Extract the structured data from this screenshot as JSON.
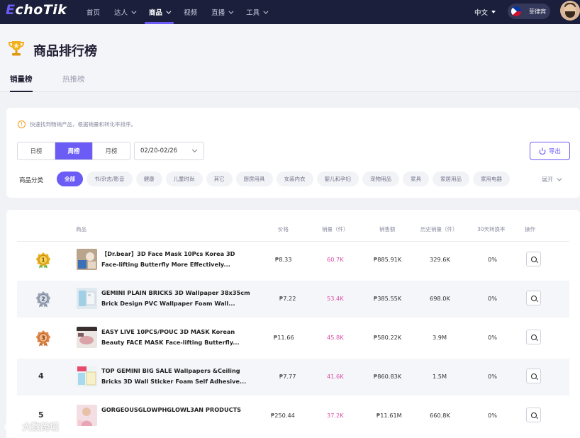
{
  "nav": {
    "logo_e": "E",
    "logo_rest": "choTik",
    "items": [
      {
        "label": "首页",
        "dropdown": false,
        "active": false
      },
      {
        "label": "达人",
        "dropdown": true,
        "active": false
      },
      {
        "label": "商品",
        "dropdown": true,
        "active": true
      },
      {
        "label": "视频",
        "dropdown": false,
        "active": false
      },
      {
        "label": "直播",
        "dropdown": true,
        "active": false
      },
      {
        "label": "工具",
        "dropdown": true,
        "active": false
      }
    ],
    "language": "中文",
    "region": "菲律宾"
  },
  "page": {
    "title": "商品排行榜",
    "tabs": [
      "销量榜",
      "热推榜"
    ]
  },
  "filters": {
    "tip": "快速找到畅销产品，根据销量和转化率排序。",
    "periods": [
      "日榜",
      "周榜",
      "月榜"
    ],
    "active_period": "周榜",
    "date_range": "02/20-02/26",
    "export_label": "导出",
    "category_label": "商品分类",
    "categories": [
      "全部",
      "书/杂志/影音",
      "健康",
      "儿童时尚",
      "其它",
      "厨房用具",
      "女装内衣",
      "婴儿和孕妇",
      "宠物用品",
      "家具",
      "家居用品",
      "家用电器"
    ],
    "active_category": "全部",
    "expand_label": "展开"
  },
  "table": {
    "headers": {
      "product": "商品",
      "price": "价格",
      "sales": "销量（件）",
      "revenue": "销售额",
      "history": "历史销量（件）",
      "conversion": "30天转换率",
      "action": "操作"
    },
    "rows": [
      {
        "rank": "1",
        "medal": "gold",
        "name_line1": "【Dr.bear】3D Face Mask 10Pcs Korea 3D",
        "name_line2": "Face-lifting Butterfly More Effectively...",
        "price": "₱8.33",
        "sales": "60.7K",
        "revenue": "₱885.91K",
        "history": "329.6K",
        "conversion": "0%"
      },
      {
        "rank": "2",
        "medal": "silver",
        "name_line1": "GEMINI PLAIN BRICKS 3D Wallpaper 38x35cm",
        "name_line2": "Brick Design PVC Wallpaper Foam Wall...",
        "price": "₱7.22",
        "sales": "53.4K",
        "revenue": "₱385.55K",
        "history": "698.0K",
        "conversion": "0%"
      },
      {
        "rank": "3",
        "medal": "bronze",
        "name_line1": "EASY LIVE 10PCS/POUC 3D MASK Korean",
        "name_line2": "Beauty FACE MASK Face-lifting Butterfly...",
        "price": "₱11.66",
        "sales": "45.8K",
        "revenue": "₱580.22K",
        "history": "3.9M",
        "conversion": "0%"
      },
      {
        "rank": "4",
        "medal": "",
        "name_line1": "TOP GEMINI BIG SALE Wallpapers &Ceiling",
        "name_line2": "Bricks 3D Wall Sticker Foam Self Adhesive...",
        "price": "₱7.77",
        "sales": "41.6K",
        "revenue": "₱860.83K",
        "history": "1.5M",
        "conversion": "0%"
      },
      {
        "rank": "5",
        "medal": "",
        "name_line1": "GORGEOUSGLOWPHGLOWL3AN PRODUCTS",
        "name_line2": "",
        "price": "₱250.44",
        "sales": "37.2K",
        "revenue": "₱11.61M",
        "history": "660.8K",
        "conversion": "0%"
      }
    ]
  },
  "watermark": "大数跨境",
  "colors": {
    "accent": "#6b5cf6",
    "nav_bg": "#1b1f3b",
    "sales_text": "#d94fa5",
    "gold": "#e8b021",
    "silver": "#9aa3b5",
    "bronze": "#e0874a"
  }
}
